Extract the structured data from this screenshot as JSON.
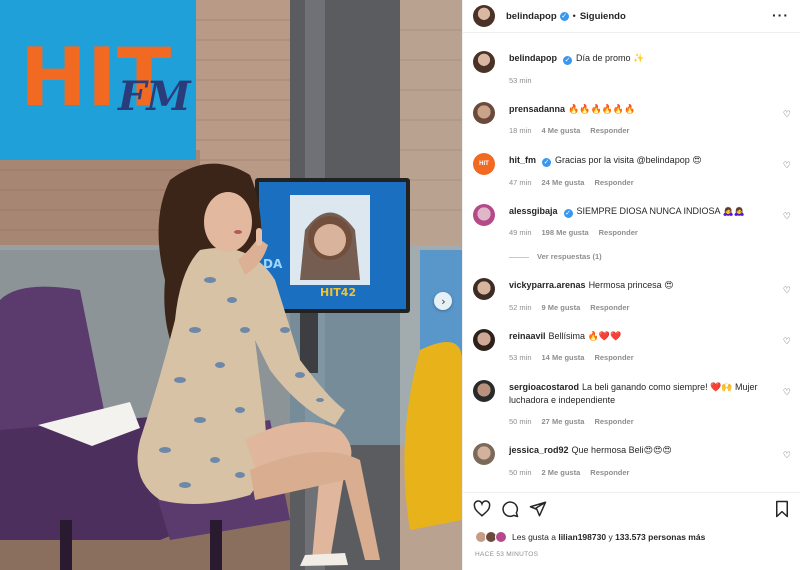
{
  "post": {
    "username": "belindapop",
    "follow_label": "Siguiendo",
    "caption": "Día de promo ✨",
    "caption_time": "53 min",
    "likes_prefix": "Les gusta a",
    "likes_user": "lilian198730",
    "likes_middle": "y",
    "likes_count": "133.573 personas más",
    "time_ago": "HACE 53 MINUTOS"
  },
  "media": {
    "sign_text": "HIT",
    "sign_sub": "FM",
    "tv_text": "HIT42",
    "tv_side": "DA"
  },
  "comments": [
    {
      "user": "prensadanna",
      "text": "🔥🔥🔥🔥🔥🔥",
      "time": "18 min",
      "likes": "4 Me gusta",
      "reply": "Responder",
      "verified": false
    },
    {
      "user": "hit_fm",
      "text": "Gracias por la visita @belindapop 😍",
      "time": "47 min",
      "likes": "24 Me gusta",
      "reply": "Responder",
      "verified": true
    },
    {
      "user": "alessgibaja",
      "text": "SIEMPRE DIOSA NUNCA INDIOSA 🙇‍♀️🙇‍♀️",
      "time": "49 min",
      "likes": "198 Me gusta",
      "reply": "Responder",
      "verified": true,
      "view_replies": "Ver respuestas (1)"
    },
    {
      "user": "vickyparra.arenas",
      "text": "Hermosa princesa 😍",
      "time": "52 min",
      "likes": "9 Me gusta",
      "reply": "Responder",
      "verified": false
    },
    {
      "user": "reinaavil",
      "text": "Bellísima 🔥❤️❤️",
      "time": "53 min",
      "likes": "14 Me gusta",
      "reply": "Responder",
      "verified": false
    },
    {
      "user": "sergioacostarod",
      "text": "La beli ganando como siempre! ❤️🙌 Mujer luchadora e independiente",
      "time": "50 min",
      "likes": "27 Me gusta",
      "reply": "Responder",
      "verified": false
    },
    {
      "user": "jessica_rod92",
      "text": "Que hermosa Beli😍😍😍",
      "time": "50 min",
      "likes": "2 Me gusta",
      "reply": "Responder",
      "verified": false
    }
  ],
  "icons": {
    "verified": "verified-badge-icon",
    "more": "more-options-icon",
    "like": "heart-icon",
    "comment": "comment-icon",
    "share": "share-icon",
    "save": "bookmark-icon",
    "next": "chevron-right-icon"
  },
  "colors": {
    "verified": "#3897f0",
    "sign_blue": "#1fa0d8",
    "sign_orange": "#f26a21",
    "chair_purple": "#5b3a6e",
    "chair_yellow": "#e8b21a"
  }
}
